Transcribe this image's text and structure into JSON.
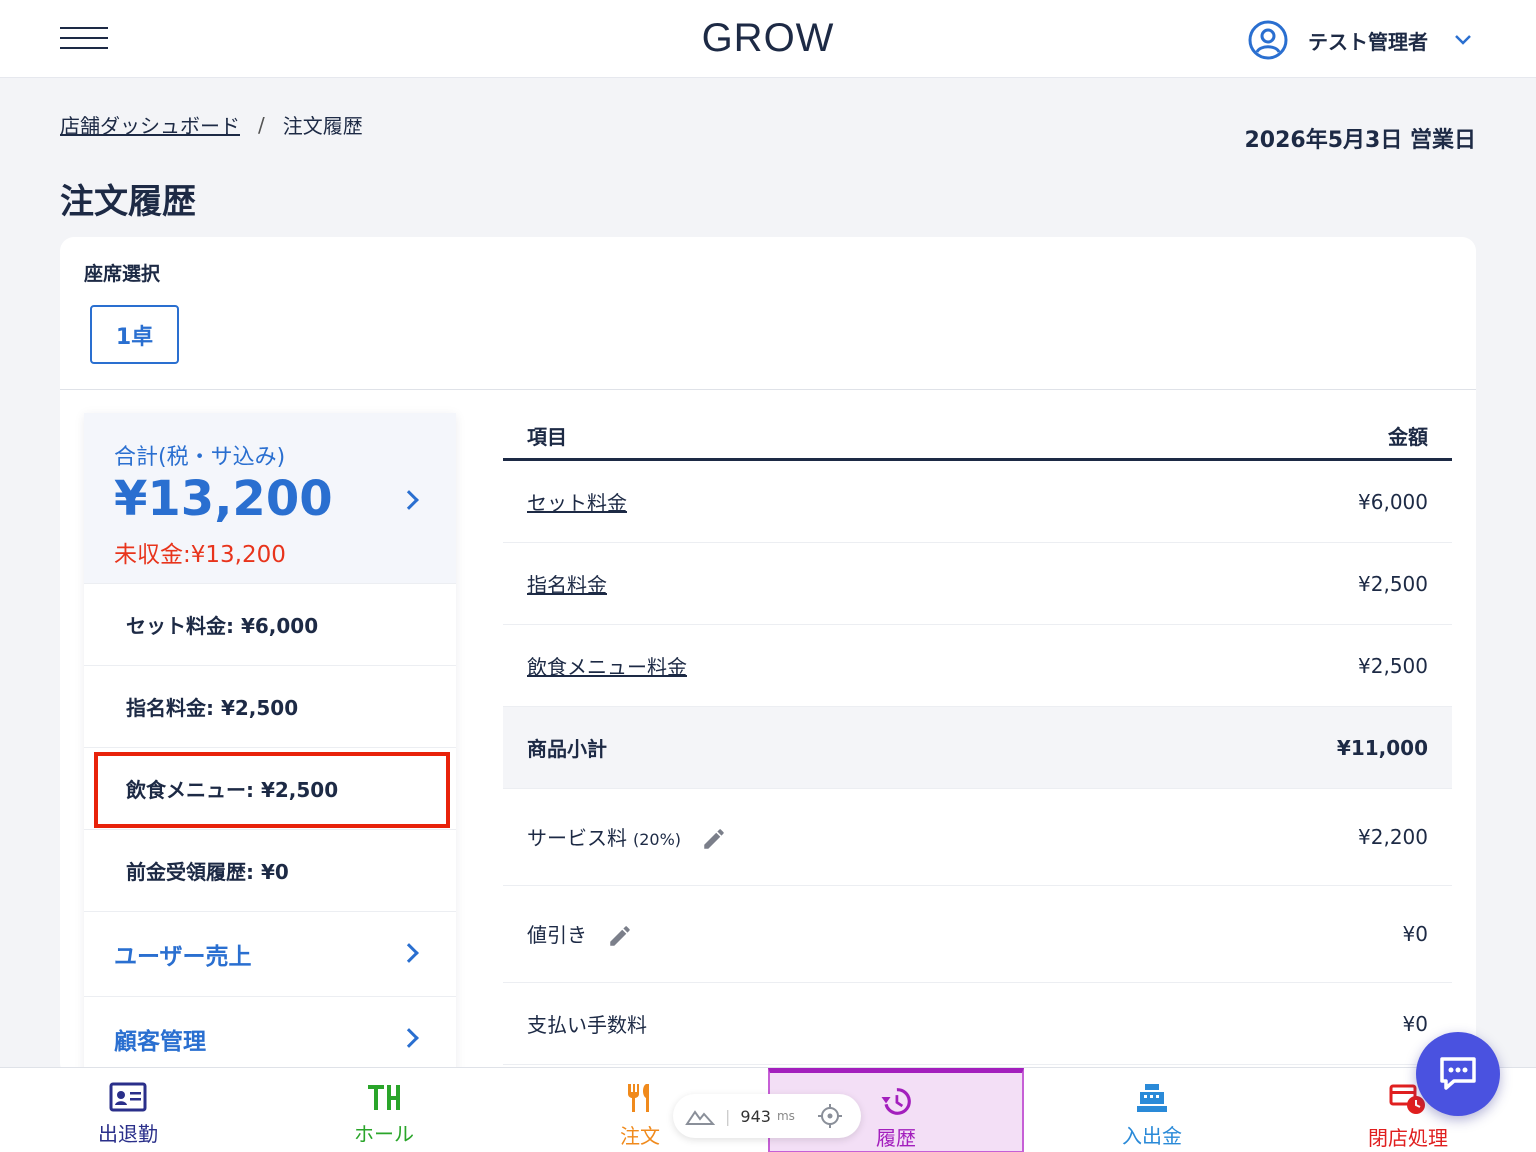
{
  "header": {
    "logo": "GROW",
    "user_name": "テスト管理者"
  },
  "breadcrumb": {
    "home": "店舗ダッシュボード",
    "separator": "/",
    "current": "注文履歴"
  },
  "business_date": "2026年5月3日 営業日",
  "page_title": "注文履歴",
  "seat": {
    "label": "座席選択",
    "selected": "1卓"
  },
  "summary": {
    "total_label": "合計(税・サ込み)",
    "total_amount": "¥13,200",
    "unpaid": "未収金:¥13,200",
    "breakdown": [
      "セット料金: ¥6,000",
      "指名料金: ¥2,500",
      "飲食メニュー: ¥2,500",
      "前金受領履歴: ¥0"
    ],
    "links": [
      "ユーザー売上",
      "顧客管理"
    ]
  },
  "table": {
    "col_item": "項目",
    "col_amount": "金額",
    "rows": [
      {
        "item": "セット料金",
        "amount": "¥6,000"
      },
      {
        "item": "指名料金",
        "amount": "¥2,500"
      },
      {
        "item": "飲食メニュー料金",
        "amount": "¥2,500"
      },
      {
        "item": "商品小計",
        "amount": "¥11,000"
      },
      {
        "item": "サービス料",
        "pct": "(20%)",
        "amount": "¥2,200"
      },
      {
        "item": "値引き",
        "amount": "¥0"
      },
      {
        "item": "支払い手数料",
        "amount": "¥0"
      }
    ]
  },
  "bottom_nav": [
    {
      "label": "出退勤",
      "color": "#2a2f8a"
    },
    {
      "label": "ホール",
      "color": "#2aa52a"
    },
    {
      "label": "注文",
      "color": "#f08a1c"
    },
    {
      "label": "履歴",
      "color": "#a31fbd"
    },
    {
      "label": "入出金",
      "color": "#2a8ad8"
    },
    {
      "label": "閉店処理",
      "color": "#e01f1f"
    }
  ],
  "perf": {
    "value": "943",
    "unit": "ms"
  },
  "colors": {
    "accent": "#2a6fd0",
    "alert": "#e8341c",
    "navy": "#1d2a45"
  }
}
